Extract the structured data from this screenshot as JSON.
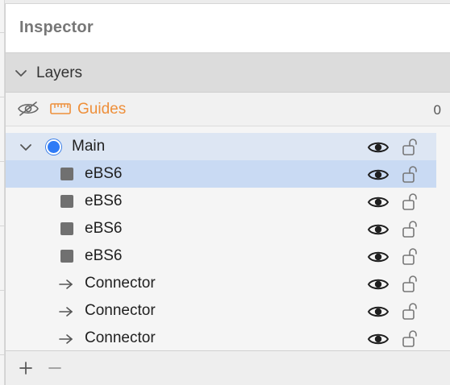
{
  "inspector": {
    "title": "Inspector"
  },
  "layers_section": {
    "label": "Layers",
    "icon": "chevron-down-icon"
  },
  "guides": {
    "label": "Guides",
    "count": "0",
    "accent_color": "#ee8f3a",
    "icons": [
      "eye-hidden-icon",
      "ruler-icon"
    ]
  },
  "layers": {
    "group": {
      "name": "Main",
      "color": "#2f7bf6",
      "icon": "chevron-down-icon"
    },
    "items": [
      {
        "name": "eBS6",
        "kind": "shape",
        "selected": true
      },
      {
        "name": "eBS6",
        "kind": "shape",
        "selected": false
      },
      {
        "name": "eBS6",
        "kind": "shape",
        "selected": false
      },
      {
        "name": "eBS6",
        "kind": "shape",
        "selected": false
      },
      {
        "name": "Connector",
        "kind": "connector",
        "selected": false
      },
      {
        "name": "Connector",
        "kind": "connector",
        "selected": false
      },
      {
        "name": "Connector",
        "kind": "connector",
        "selected": false
      }
    ],
    "row_icons": [
      "eye-icon",
      "unlock-icon"
    ]
  },
  "footer": {
    "add_icon": "plus-icon",
    "remove_icon": "minus-icon"
  },
  "colors": {
    "selection": "#c9daf3",
    "group_row": "#dde6f3",
    "section_bar": "#dcdcdc"
  }
}
